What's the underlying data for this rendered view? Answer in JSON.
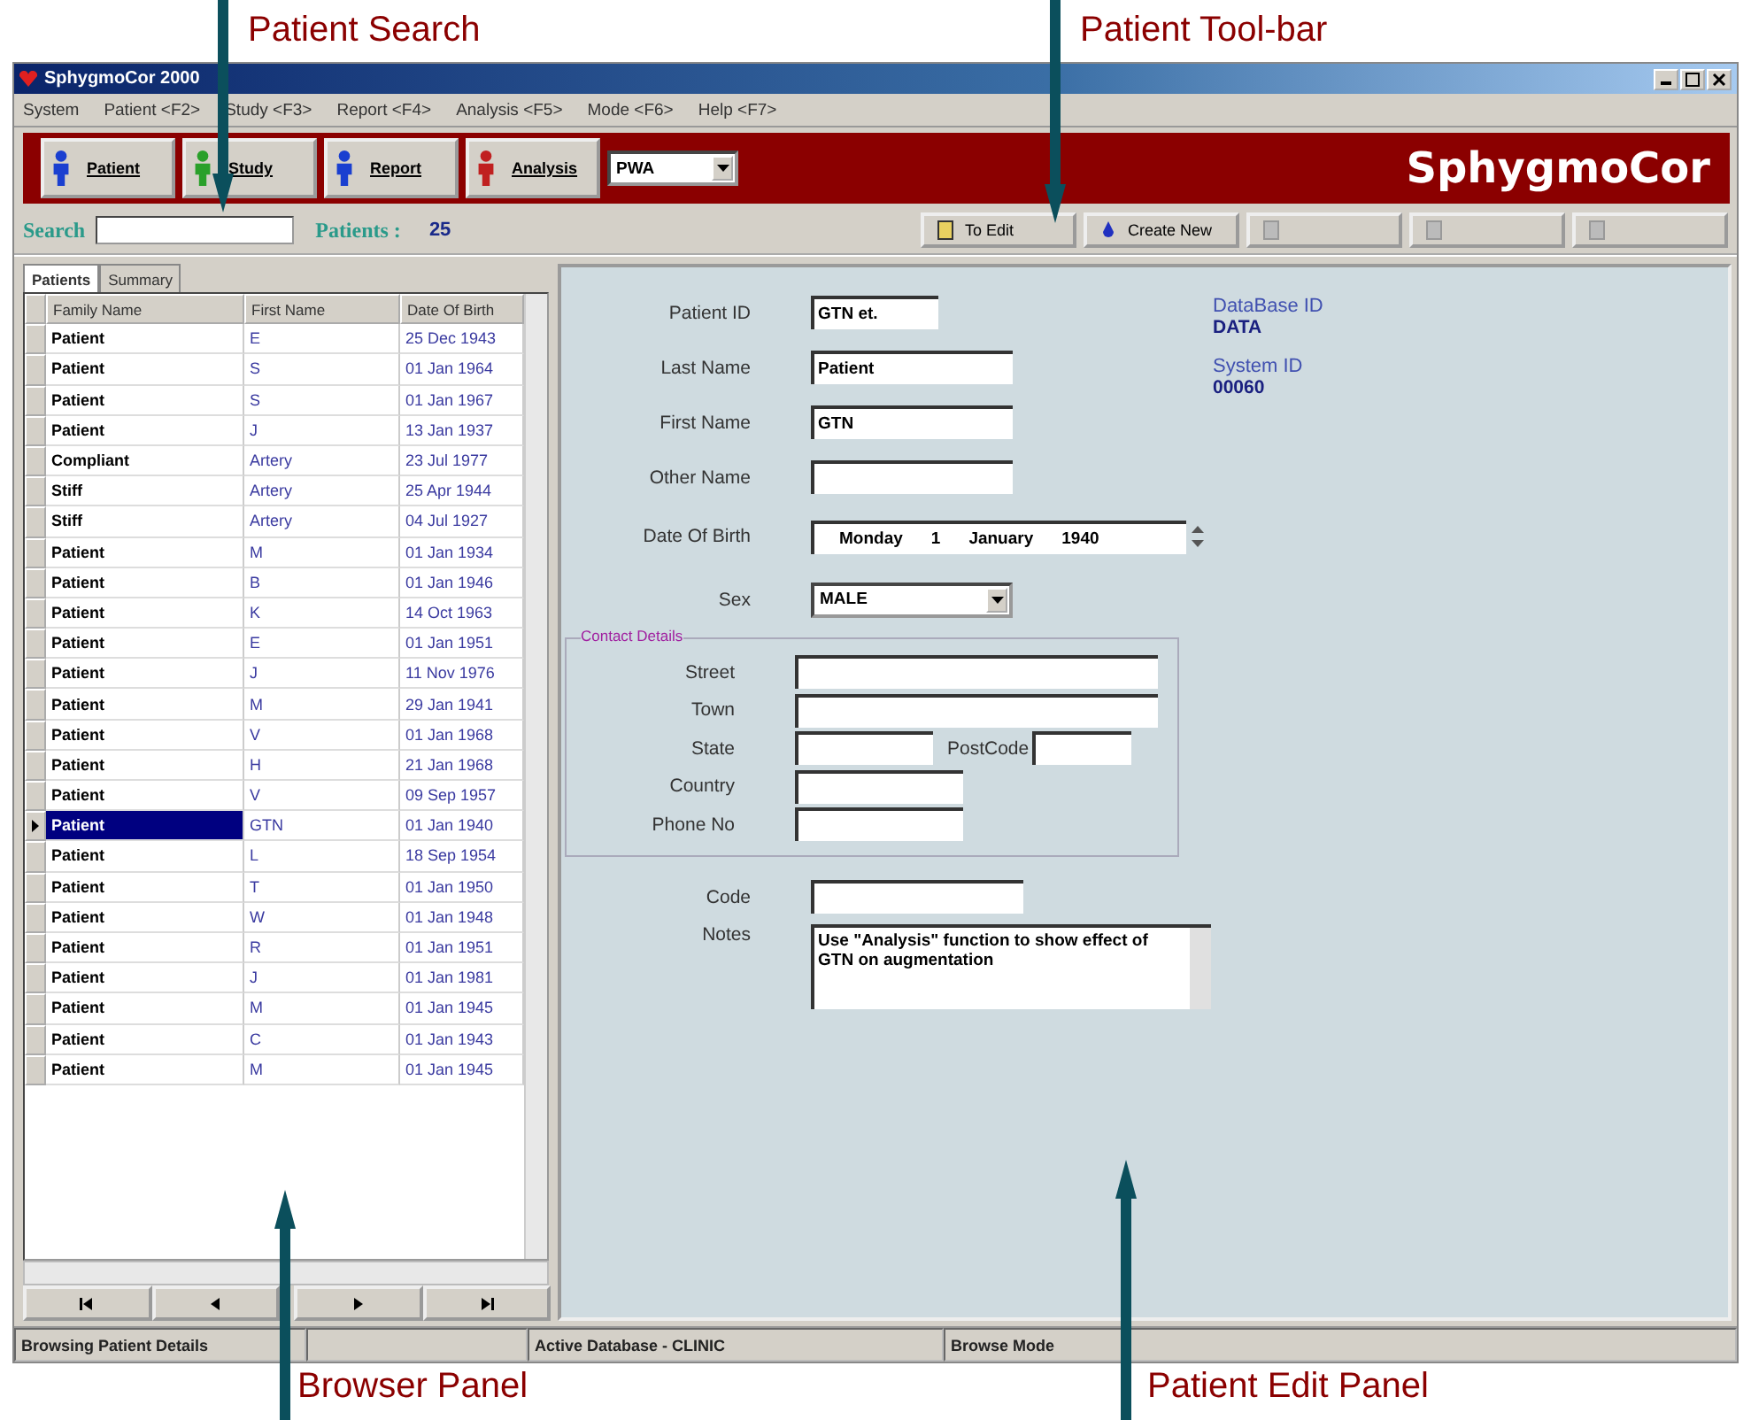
{
  "callouts": [
    {
      "label": "Patient Search",
      "kind": "above"
    },
    {
      "label": "Patient Tool-bar",
      "kind": "above"
    },
    {
      "label": "Browser Panel",
      "kind": "below"
    },
    {
      "label": "Patient Edit Panel",
      "kind": "below"
    }
  ],
  "window": {
    "title": "SphygmoCor 2000"
  },
  "menu": [
    "System",
    "Patient <F2>",
    "Study <F3>",
    "Report <F4>",
    "Analysis <F5>",
    "Mode <F6>",
    "Help <F7>"
  ],
  "toolbar": {
    "buttons": [
      {
        "label": "Patient"
      },
      {
        "label": "Study"
      },
      {
        "label": "Report"
      },
      {
        "label": "Analysis"
      }
    ],
    "mode": "PWA",
    "logo": "SphygmoCor"
  },
  "search": {
    "label": "Search",
    "count_label": "Patients :",
    "count": "25"
  },
  "actions": [
    {
      "label": "To Edit",
      "disabled": false
    },
    {
      "label": "Create New",
      "disabled": false
    },
    {
      "disabled": true
    },
    {
      "disabled": true
    },
    {
      "disabled": true
    }
  ],
  "tabs": [
    {
      "label": "Patients",
      "selected": true
    },
    {
      "label": "Summary",
      "selected": false
    }
  ],
  "table": {
    "columns": [
      "Family Name",
      "First Name",
      "Date Of Birth"
    ],
    "rows": [
      {
        "family": "Patient",
        "first": "E",
        "dob": "25 Dec 1943",
        "selected": false
      },
      {
        "family": "Patient",
        "first": "S",
        "dob": "01 Jan 1964",
        "selected": false
      },
      {
        "family": "Patient",
        "first": "S",
        "dob": "01 Jan 1967",
        "selected": false
      },
      {
        "family": "Patient",
        "first": "J",
        "dob": "13 Jan 1937",
        "selected": false
      },
      {
        "family": "Compliant",
        "first": "Artery",
        "dob": "23 Jul 1977",
        "selected": false
      },
      {
        "family": "Stiff",
        "first": "Artery",
        "dob": "25 Apr 1944",
        "selected": false
      },
      {
        "family": "Stiff",
        "first": "Artery",
        "dob": "04 Jul 1927",
        "selected": false
      },
      {
        "family": "Patient",
        "first": "M",
        "dob": "01 Jan 1934",
        "selected": false
      },
      {
        "family": "Patient",
        "first": "B",
        "dob": "01 Jan 1946",
        "selected": false
      },
      {
        "family": "Patient",
        "first": "K",
        "dob": "14 Oct 1963",
        "selected": false
      },
      {
        "family": "Patient",
        "first": "E",
        "dob": "01 Jan 1951",
        "selected": false
      },
      {
        "family": "Patient",
        "first": "J",
        "dob": "11 Nov 1976",
        "selected": false
      },
      {
        "family": "Patient",
        "first": "M",
        "dob": "29 Jan 1941",
        "selected": false
      },
      {
        "family": "Patient",
        "first": "V",
        "dob": "01 Jan 1968",
        "selected": false
      },
      {
        "family": "Patient",
        "first": "H",
        "dob": "21 Jan 1968",
        "selected": false
      },
      {
        "family": "Patient",
        "first": "V",
        "dob": "09 Sep 1957",
        "selected": false
      },
      {
        "family": "Patient",
        "first": "GTN",
        "dob": "01 Jan 1940",
        "selected": true
      },
      {
        "family": "Patient",
        "first": "L",
        "dob": "18 Sep 1954",
        "selected": false
      },
      {
        "family": "Patient",
        "first": "T",
        "dob": "01 Jan 1950",
        "selected": false
      },
      {
        "family": "Patient",
        "first": "W",
        "dob": "01 Jan 1948",
        "selected": false
      },
      {
        "family": "Patient",
        "first": "R",
        "dob": "01 Jan 1951",
        "selected": false
      },
      {
        "family": "Patient",
        "first": "J",
        "dob": "01 Jan 1981",
        "selected": false
      },
      {
        "family": "Patient",
        "first": "M",
        "dob": "01 Jan 1945",
        "selected": false
      },
      {
        "family": "Patient",
        "first": "C",
        "dob": "01 Jan 1943",
        "selected": false
      },
      {
        "family": "Patient",
        "first": "M",
        "dob": "01 Jan 1945",
        "selected": false
      }
    ]
  },
  "form": {
    "fields": [
      {
        "label": "Patient ID",
        "value": "GTN et.",
        "kind": "short"
      },
      {
        "label": "Last Name",
        "value": "Patient",
        "kind": "text"
      },
      {
        "label": "First Name",
        "value": "GTN",
        "kind": "text"
      },
      {
        "label": "Other Name",
        "kind": "text"
      }
    ],
    "ids": [
      {
        "label": "DataBase ID",
        "value": "DATA"
      },
      {
        "label": "System ID",
        "value": "00060"
      }
    ],
    "dob": {
      "label": "Date Of Birth",
      "day": "Monday",
      "date": "1",
      "month": "January",
      "year": "1940"
    },
    "sex": {
      "label": "Sex",
      "value": "MALE"
    },
    "contact": {
      "title": "Contact Details",
      "street": "Street",
      "town": "Town",
      "state": "State",
      "postcode": "PostCode",
      "country": "Country",
      "phone": "Phone No"
    },
    "code": {
      "label": "Code"
    },
    "notes": {
      "label": "Notes",
      "value": "Use \"Analysis\" function to show effect of GTN on augmentation"
    }
  },
  "status_bar": [
    "Browsing Patient Details",
    "Active Database - CLINIC",
    "Browse Mode"
  ]
}
